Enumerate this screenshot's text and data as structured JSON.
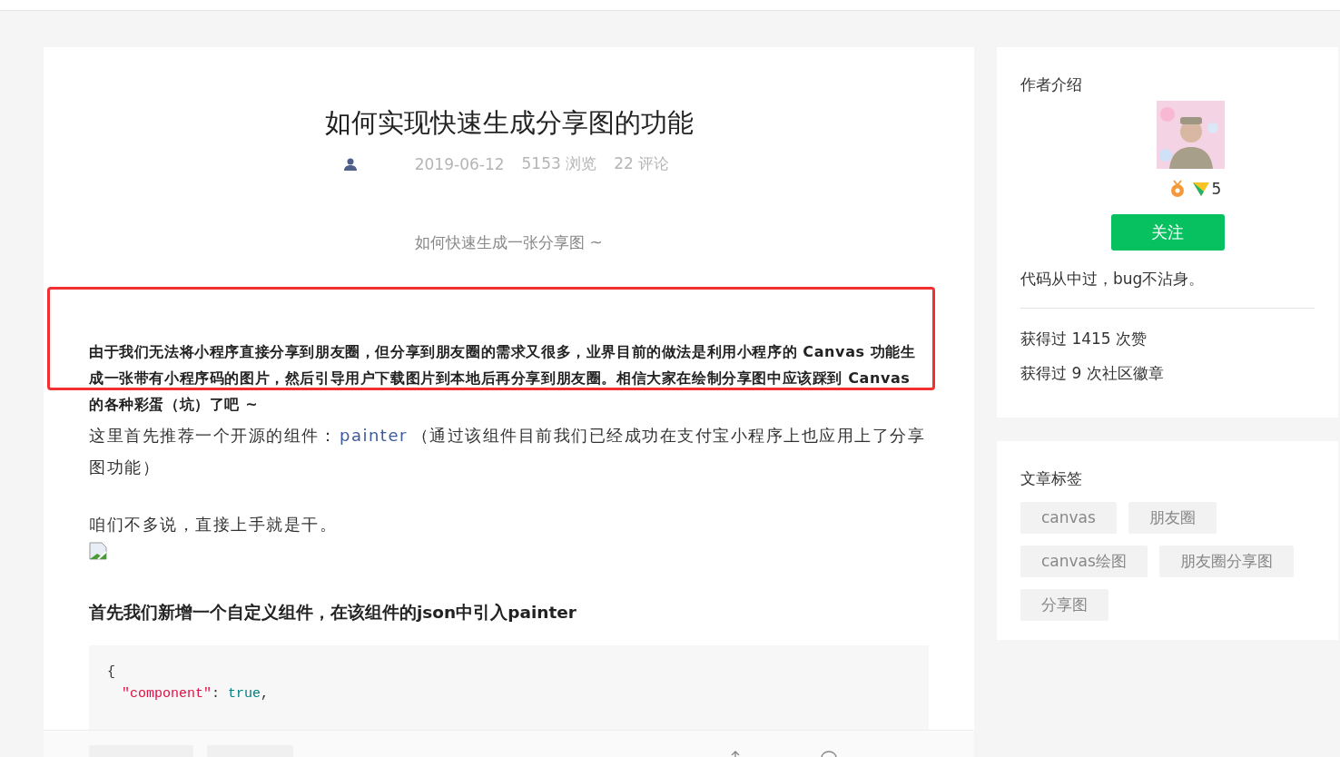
{
  "article": {
    "title": "如何实现快速生成分享图的功能",
    "meta": {
      "date": "2019-06-12",
      "views": "5153 浏览",
      "comments": "22 评论"
    },
    "subtitle": "如何快速生成一张分享图 ~",
    "highlight": "由于我们无法将小程序直接分享到朋友圈，但分享到朋友圈的需求又很多，业界目前的做法是利用小程序的 Canvas 功能生成一张带有小程序码的图片，然后引导用户下载图片到本地后再分享到朋友圈。相信大家在绘制分享图中应该踩到 Canvas 的各种彩蛋（坑）了吧 ~",
    "intro_before": "这里首先推荐一个开源的组件：",
    "intro_link": "painter",
    "intro_after": "（通过该组件目前我们已经成功在支付宝小程序上也应用上了分享图功能）",
    "para": "咱们不多说，直接上手就是干。",
    "heading": "首先我们新增一个自定义组件，在该组件的json中引入painter",
    "code": [
      {
        "kind": "plain",
        "text": "{"
      },
      {
        "kind": "pair",
        "key": "\"component\"",
        "sep": ":",
        "value": "true",
        "end": ","
      }
    ]
  },
  "author": {
    "heading": "作者介绍",
    "level": "5",
    "follow": "关注",
    "bio": "代码从中过，bug不沾身。",
    "stats": [
      "获得过 1415 次赞",
      "获得过 9 次社区徽章"
    ]
  },
  "tags": {
    "heading": "文章标签",
    "items": [
      "canvas",
      "朋友圈",
      "canvas绘图",
      "朋友圈分享图",
      "分享图"
    ]
  }
}
